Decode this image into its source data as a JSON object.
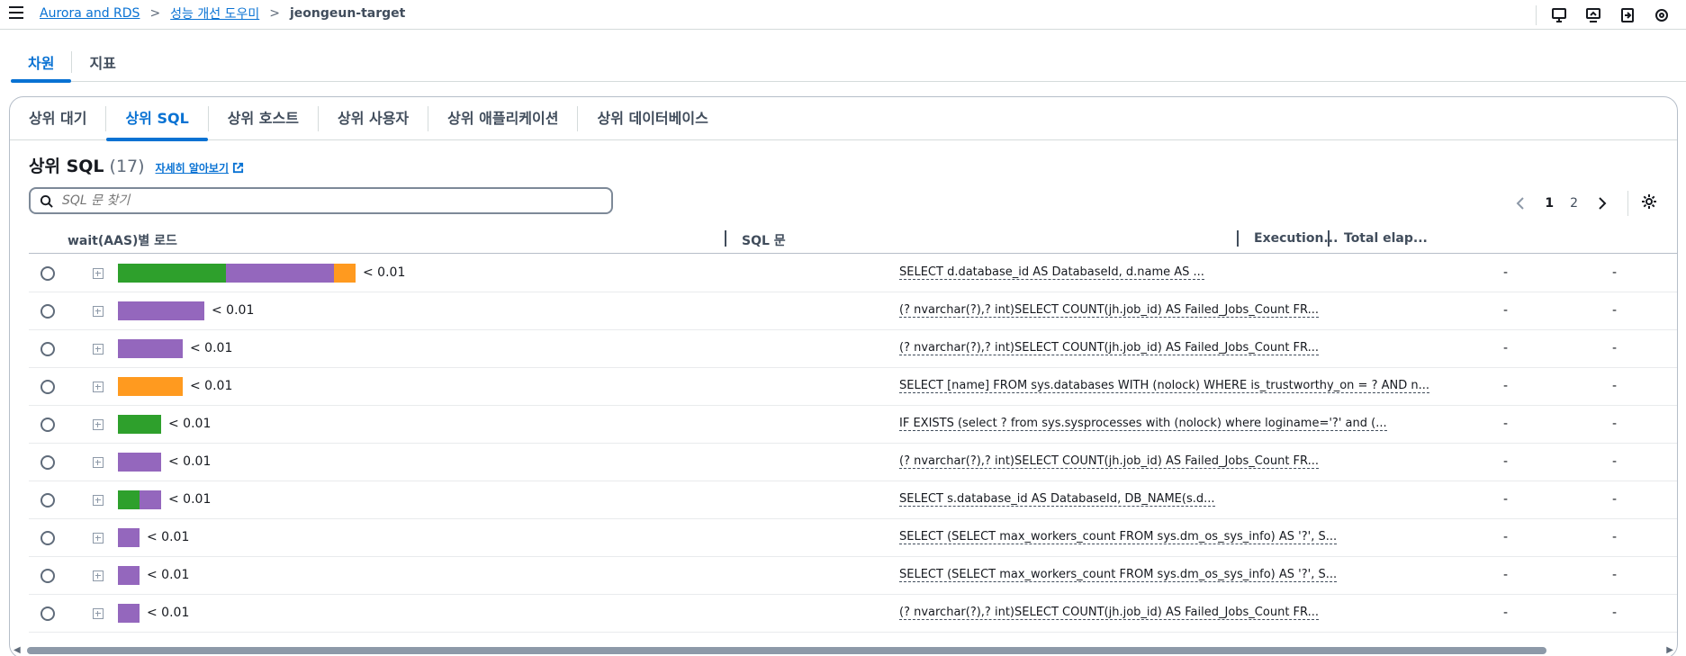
{
  "breadcrumb": {
    "items": [
      "Aurora and RDS",
      "성능 개선 도우미"
    ],
    "current": "jeongeun-target"
  },
  "top_icons": [
    "monitor-icon",
    "screen-icon",
    "export-icon",
    "settings-icon"
  ],
  "main_tabs": [
    {
      "label": "차원",
      "active": true
    },
    {
      "label": "지표",
      "active": false
    }
  ],
  "sub_tabs": [
    {
      "label": "상위 대기",
      "active": false
    },
    {
      "label": "상위 SQL",
      "active": true
    },
    {
      "label": "상위 호스트",
      "active": false
    },
    {
      "label": "상위 사용자",
      "active": false
    },
    {
      "label": "상위 애플리케이션",
      "active": false
    },
    {
      "label": "상위 데이터베이스",
      "active": false
    }
  ],
  "panel": {
    "title": "상위 SQL",
    "count": "(17)",
    "learn_more": "자세히 알아보기"
  },
  "search": {
    "placeholder": "SQL 문 찾기",
    "value": ""
  },
  "pagination": {
    "pages": [
      "1",
      "2"
    ],
    "current": "1"
  },
  "colors": {
    "green": "#2ea02c",
    "purple": "#9467bd",
    "orange": "#ff9a1f",
    "accent": "#0972d3"
  },
  "table": {
    "columns": [
      "wait(AAS)별 로드",
      "SQL 문",
      "Execution...",
      "Total elap..."
    ],
    "rows": [
      {
        "load": "< 0.01",
        "segments": [
          {
            "color": "green",
            "value": 0.0045
          },
          {
            "color": "purple",
            "value": 0.0045
          },
          {
            "color": "orange",
            "value": 0.0009
          }
        ],
        "sql": "SELECT d.database_id AS DatabaseId, d.name AS ...",
        "execution": "-",
        "total_elapsed": "-"
      },
      {
        "load": "< 0.01",
        "segments": [
          {
            "color": "purple",
            "value": 0.0036
          }
        ],
        "sql": "(? nvarchar(?),? int)SELECT COUNT(jh.job_id) AS Failed_Jobs_Count FR...",
        "execution": "-",
        "total_elapsed": "-"
      },
      {
        "load": "< 0.01",
        "segments": [
          {
            "color": "purple",
            "value": 0.0027
          }
        ],
        "sql": "(? nvarchar(?),? int)SELECT COUNT(jh.job_id) AS Failed_Jobs_Count FR...",
        "execution": "-",
        "total_elapsed": "-"
      },
      {
        "load": "< 0.01",
        "segments": [
          {
            "color": "orange",
            "value": 0.0027
          }
        ],
        "sql": "SELECT [name] FROM sys.databases WITH (nolock) WHERE is_trustworthy_on = ? AND n...",
        "execution": "-",
        "total_elapsed": "-"
      },
      {
        "load": "< 0.01",
        "segments": [
          {
            "color": "green",
            "value": 0.0018
          }
        ],
        "sql": "IF EXISTS (select ? from sys.sysprocesses with (nolock) where loginame='?' and (...",
        "execution": "-",
        "total_elapsed": "-"
      },
      {
        "load": "< 0.01",
        "segments": [
          {
            "color": "purple",
            "value": 0.0018
          }
        ],
        "sql": "(? nvarchar(?),? int)SELECT COUNT(jh.job_id) AS Failed_Jobs_Count FR...",
        "execution": "-",
        "total_elapsed": "-"
      },
      {
        "load": "< 0.01",
        "segments": [
          {
            "color": "green",
            "value": 0.0009
          },
          {
            "color": "purple",
            "value": 0.0009
          }
        ],
        "sql": "SELECT s.database_id AS DatabaseId, DB_NAME(s.d...",
        "execution": "-",
        "total_elapsed": "-"
      },
      {
        "load": "< 0.01",
        "segments": [
          {
            "color": "purple",
            "value": 0.0009
          }
        ],
        "sql": "SELECT (SELECT max_workers_count FROM sys.dm_os_sys_info) AS '?', S...",
        "execution": "-",
        "total_elapsed": "-"
      },
      {
        "load": "< 0.01",
        "segments": [
          {
            "color": "purple",
            "value": 0.0009
          }
        ],
        "sql": "SELECT (SELECT max_workers_count FROM sys.dm_os_sys_info) AS '?', S...",
        "execution": "-",
        "total_elapsed": "-"
      },
      {
        "load": "< 0.01",
        "segments": [
          {
            "color": "purple",
            "value": 0.0009
          }
        ],
        "sql": "(? nvarchar(?),? int)SELECT COUNT(jh.job_id) AS Failed_Jobs_Count FR...",
        "execution": "-",
        "total_elapsed": "-"
      }
    ]
  }
}
